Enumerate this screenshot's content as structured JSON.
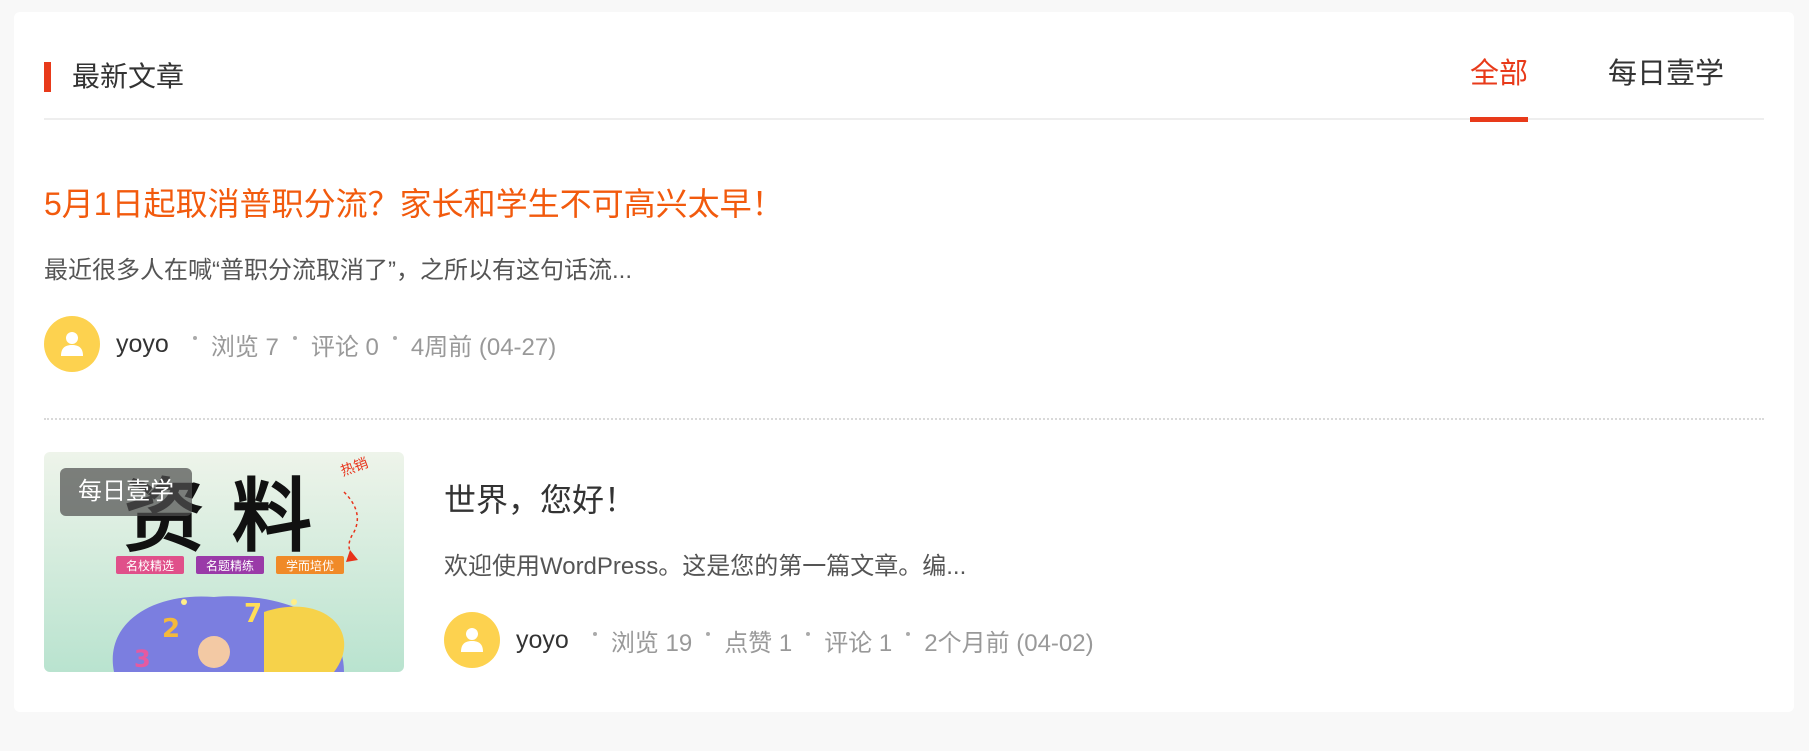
{
  "header": {
    "section_title": "最新文章",
    "tabs": [
      {
        "label": "全部",
        "active": true
      },
      {
        "label": "每日壹学",
        "active": false
      }
    ]
  },
  "articles": [
    {
      "title": "5月1日起取消普职分流？家长和学生不可高兴太早！",
      "excerpt": "最近很多人在喊“普职分流取消了”，之所以有这句话流...",
      "author": "yoyo",
      "stats": [
        "浏览 7",
        "评论 0",
        "4周前 (04-27)"
      ]
    },
    {
      "title": "世界，您好！",
      "excerpt": "欢迎使用WordPress。这是您的第一篇文章。编...",
      "author": "yoyo",
      "category_badge": "每日壹学",
      "thumbnail": {
        "big_text": "资 料",
        "subtitle_tags": [
          "名校精选",
          "名题精练",
          "学而培优"
        ],
        "corner_tag": "热销"
      },
      "stats": [
        "浏览 19",
        "点赞 1",
        "评论 1",
        "2个月前 (04-02)"
      ]
    }
  ],
  "colors": {
    "accent": "#e83a1a",
    "title_orange": "#f25a0d",
    "avatar_bg": "#fdd24f",
    "meta_gray": "#999999"
  },
  "icons": {
    "avatar": "user-icon"
  }
}
